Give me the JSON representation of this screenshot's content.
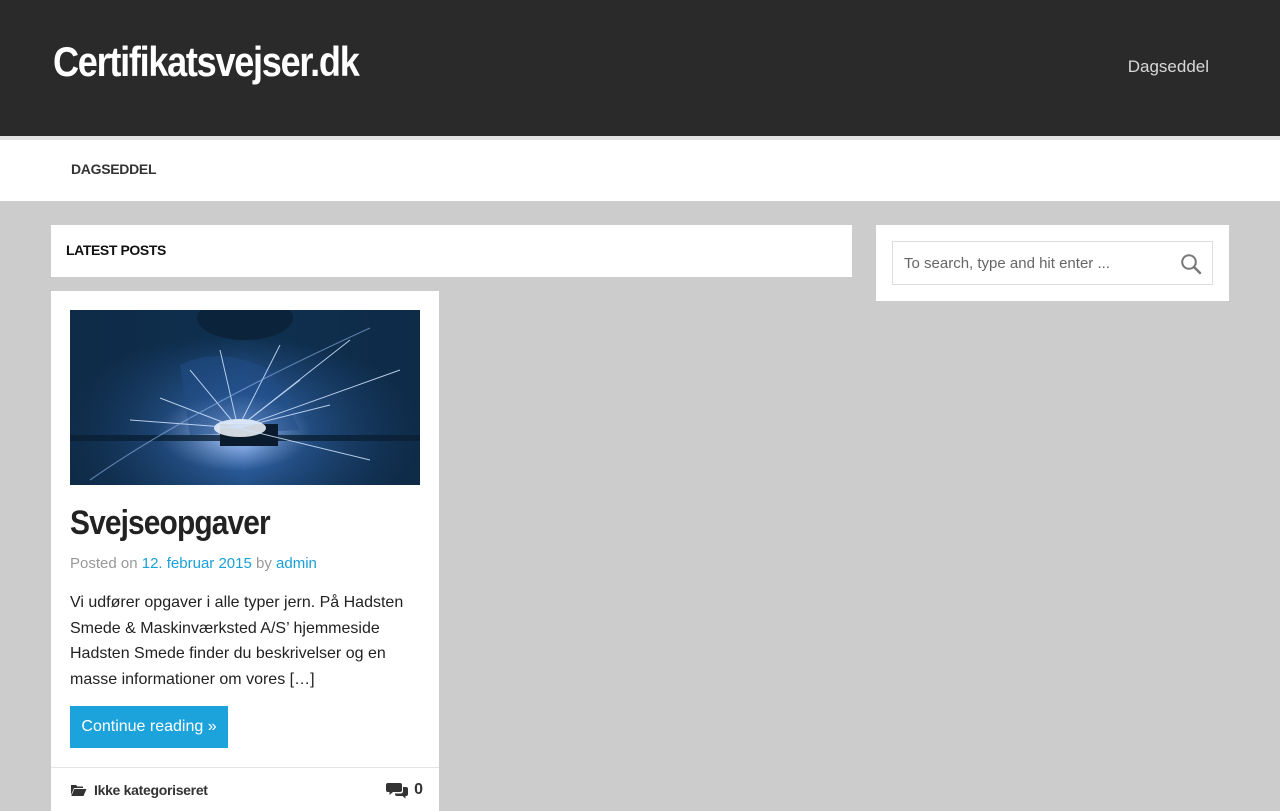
{
  "header": {
    "site_title": "Certifikatsvejser.dk",
    "top_link": "Dagseddel"
  },
  "nav": {
    "items": [
      {
        "label": "DAGSEDDEL"
      }
    ]
  },
  "main": {
    "section_title": "LATEST POSTS",
    "posts": [
      {
        "title": "Svejseopgaver",
        "meta_prefix": "Posted on",
        "date": "12. februar 2015",
        "meta_by": "by",
        "author": "admin",
        "excerpt": "Vi udfører opgaver i alle typer jern. På Hadsten Smede & Maskinværksted A/S’ hjemmeside Hadsten Smede finder du beskrivelser og en masse informationer om vores […]",
        "button_label": "Continue reading »",
        "category": "Ikke kategoriseret",
        "comment_count": "0"
      }
    ]
  },
  "sidebar": {
    "search": {
      "placeholder": "To search, type and hit enter ..."
    }
  },
  "colors": {
    "header_bg": "#2a2a2a",
    "page_bg": "#cccccc",
    "accent": "#1da3db",
    "link": "#1aa0d8"
  },
  "icons": [
    "welding-photo",
    "folder-icon",
    "comments-icon",
    "search-icon"
  ]
}
